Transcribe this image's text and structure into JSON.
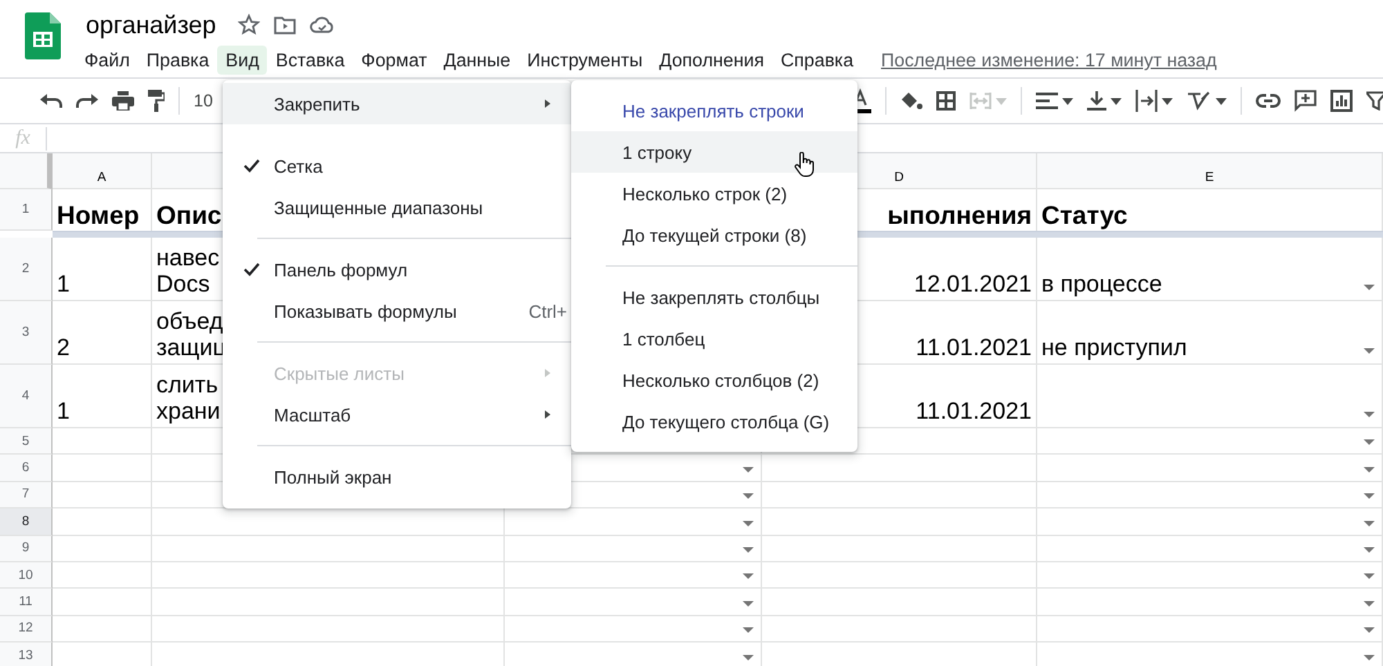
{
  "document": {
    "title": "органайзер"
  },
  "menu_bar": [
    {
      "label": "Файл",
      "selected": false
    },
    {
      "label": "Правка",
      "selected": false
    },
    {
      "label": "Вид",
      "selected": true
    },
    {
      "label": "Вставка",
      "selected": false
    },
    {
      "label": "Формат",
      "selected": false
    },
    {
      "label": "Данные",
      "selected": false
    },
    {
      "label": "Инструменты",
      "selected": false
    },
    {
      "label": "Дополнения",
      "selected": false
    },
    {
      "label": "Справка",
      "selected": false
    }
  ],
  "last_edit": "Последнее изменение: 17 минут назад",
  "toolbar": {
    "zoom": "10",
    "merge_disabled": true
  },
  "formula_bar": {
    "label": "fx"
  },
  "column_headers": {
    "a": "A",
    "d": "D",
    "e": "E"
  },
  "rows": [
    {
      "label": "1",
      "kind": "header",
      "selected": false,
      "a": "Номер",
      "b": "Опис",
      "d": "ыполнения",
      "e": "Статус"
    },
    {
      "label": "2",
      "kind": "tall",
      "selected": false,
      "a": "1",
      "b": "навес\nDocs",
      "d": "12.01.2021",
      "e": "в процессе",
      "dropdown_e": true
    },
    {
      "label": "3",
      "kind": "tall",
      "selected": false,
      "a": "2",
      "b": "объед\nзащиц",
      "d": "11.01.2021",
      "e": "не приступил",
      "dropdown_e": true
    },
    {
      "label": "4",
      "kind": "tall",
      "selected": false,
      "a": "1",
      "b": "слить\nхрани",
      "d": "11.01.2021",
      "dropdown_e": true
    },
    {
      "label": "5",
      "kind": "blank",
      "selected": false,
      "dropdown_e": true
    },
    {
      "label": "6",
      "kind": "blank",
      "selected": false,
      "dropdown_c": true,
      "dropdown_e": true
    },
    {
      "label": "7",
      "kind": "blank",
      "selected": false,
      "dropdown_c": true,
      "dropdown_e": true
    },
    {
      "label": "8",
      "kind": "blank",
      "selected": true,
      "dropdown_c": true,
      "dropdown_e": true
    },
    {
      "label": "9",
      "kind": "blank",
      "selected": false,
      "dropdown_c": true,
      "dropdown_e": true
    },
    {
      "label": "10",
      "kind": "blank",
      "selected": false,
      "dropdown_c": true,
      "dropdown_e": true
    },
    {
      "label": "11",
      "kind": "blank",
      "selected": false,
      "dropdown_c": true,
      "dropdown_e": true
    },
    {
      "label": "12",
      "kind": "blank",
      "selected": false,
      "dropdown_c": true,
      "dropdown_e": true
    },
    {
      "label": "13",
      "kind": "blank",
      "selected": false,
      "dropdown_c": true,
      "dropdown_e": true
    }
  ],
  "view_menu": [
    {
      "kind": "submenu",
      "label": "Закрепить",
      "selected": true,
      "checked": false,
      "disabled": false
    },
    {
      "kind": "spacer"
    },
    {
      "kind": "item",
      "label": "Сетка",
      "selected": false,
      "checked": true,
      "disabled": false
    },
    {
      "kind": "item",
      "label": "Защищенные диапазоны",
      "selected": false,
      "checked": false,
      "disabled": false
    },
    {
      "kind": "divider"
    },
    {
      "kind": "item",
      "label": "Панель формул",
      "selected": false,
      "checked": true,
      "disabled": false
    },
    {
      "kind": "item",
      "label": "Показывать формулы",
      "shortcut": "Ctrl+",
      "selected": false,
      "checked": false,
      "disabled": false
    },
    {
      "kind": "divider"
    },
    {
      "kind": "submenu",
      "label": "Скрытые листы",
      "selected": false,
      "checked": false,
      "disabled": true
    },
    {
      "kind": "submenu",
      "label": "Масштаб",
      "selected": false,
      "checked": false,
      "disabled": false
    },
    {
      "kind": "divider"
    },
    {
      "kind": "item",
      "label": "Полный экран",
      "selected": false,
      "checked": false,
      "disabled": false
    }
  ],
  "freeze_submenu": [
    {
      "kind": "item",
      "label": "Не закреплять строки",
      "selected": false,
      "current": true
    },
    {
      "kind": "item",
      "label": "1 строку",
      "selected": true,
      "current": false
    },
    {
      "kind": "item",
      "label": "Несколько строк (2)",
      "selected": false,
      "current": false
    },
    {
      "kind": "item",
      "label": "До текущей строки (8)",
      "selected": false,
      "current": false
    },
    {
      "kind": "divider"
    },
    {
      "kind": "item",
      "label": "Не закреплять столбцы",
      "selected": false,
      "current": false
    },
    {
      "kind": "item",
      "label": "1 столбец",
      "selected": false,
      "current": false
    },
    {
      "kind": "item",
      "label": "Несколько столбцов (2)",
      "selected": false,
      "current": false
    },
    {
      "kind": "item",
      "label": "До текущего столбца (G)",
      "selected": false,
      "current": false
    }
  ]
}
